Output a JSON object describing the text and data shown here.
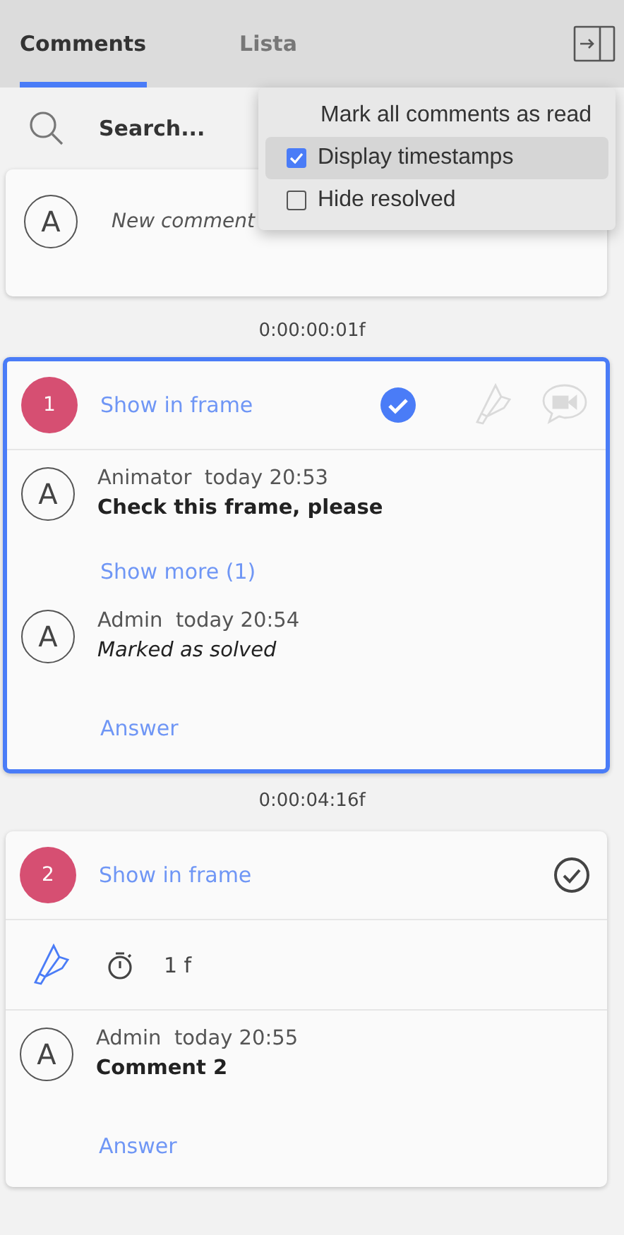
{
  "tabs": [
    {
      "label": "Comments",
      "selected": true
    },
    {
      "label": "Lista",
      "selected": false
    }
  ],
  "menu": [
    {
      "label": "Mark all comments as read",
      "kind": "action",
      "highlighted": false
    },
    {
      "label": "Display timestamps",
      "kind": "checkbox",
      "checked": true,
      "highlighted": true
    },
    {
      "label": "Hide resolved",
      "kind": "checkbox",
      "checked": false,
      "highlighted": false
    }
  ],
  "search": {
    "placeholder": "Search..."
  },
  "new_comment": {
    "avatar": "A",
    "placeholder": "New comment"
  },
  "threads": [
    {
      "timestamp": "0:00:00:01f",
      "number": "1",
      "link": "Show in frame",
      "resolved": true,
      "selected": true,
      "comments": [
        {
          "avatar": "A",
          "author": "Animator",
          "time": "today 20:53",
          "text": "Check this frame, please",
          "kind": "text"
        }
      ],
      "show_more": "Show more (1)",
      "replies": [
        {
          "avatar": "A",
          "author": "Admin",
          "time": "today 20:54",
          "text": "Marked as solved",
          "kind": "system"
        }
      ],
      "answer": "Answer"
    },
    {
      "timestamp": "0:00:04:16f",
      "number": "2",
      "link": "Show in frame",
      "resolved": false,
      "selected": false,
      "annotation": {
        "duration": "1 f"
      },
      "comments": [
        {
          "avatar": "A",
          "author": "Admin",
          "time": "today 20:55",
          "text": "Comment 2",
          "kind": "text"
        }
      ],
      "answer": "Answer"
    }
  ]
}
